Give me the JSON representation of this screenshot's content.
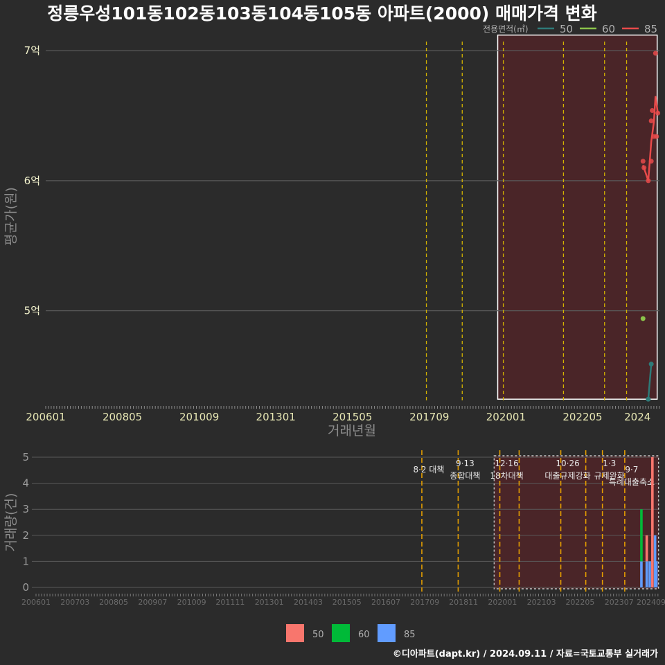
{
  "title": "정릉우성101동102동103동104동105동 아파트(2000) 매매가격 변화",
  "credit": "©디아파트(dapt.kr) / 2024.09.11 / 자료=국토교통부 실거래가",
  "colors": {
    "background": "#2b2b2b",
    "grid": "#5a5a5a",
    "policy_line": "#d4b400",
    "policy_line_bottom": "#e69f00",
    "highlight_fill": "#4a2528",
    "s50": "#2e7a78",
    "s60": "#8bc34a",
    "s85": "#e84a4a",
    "bar50": "#f8766d",
    "bar60": "#00ba38",
    "bar85": "#619cff"
  },
  "chart_data": [
    {
      "type": "line",
      "name": "price",
      "ylabel": "평균가(원)",
      "xlabel": "거래년월",
      "ylim": [
        4.3,
        7.15
      ],
      "ytick_values": [
        5,
        6,
        7
      ],
      "ytick_labels": [
        "5억",
        "6억",
        "7억"
      ],
      "x_range": [
        2006.0,
        2024.67
      ],
      "xtick_values": [
        2006.0,
        2008.33,
        2010.67,
        2013.0,
        2015.33,
        2017.67,
        2020.0,
        2022.33,
        2024.0
      ],
      "xtick_labels": [
        "200601",
        "200805",
        "201009",
        "201301",
        "201505",
        "201709",
        "202001",
        "202205",
        "2024"
      ],
      "policy_lines_x": [
        2017.58,
        2018.67,
        2019.92,
        2021.75,
        2023.0,
        2023.67
      ],
      "highlight_x": [
        2019.75,
        2024.6
      ],
      "highlight_y": [
        4.32,
        7.12
      ],
      "legend_title": "전용면적(㎡)",
      "series": [
        {
          "name": "50",
          "color": "#2e7a78",
          "x": [
            2024.33,
            2024.42
          ],
          "y": [
            4.32,
            4.59
          ]
        },
        {
          "name": "60",
          "color": "#8bc34a",
          "x": [
            2024.17
          ],
          "y": [
            4.94
          ]
        },
        {
          "name": "85",
          "color": "#e84a4a",
          "points_x": [
            2024.17,
            2024.2,
            2024.33,
            2024.42,
            2024.42,
            2024.45,
            2024.5,
            2024.55,
            2024.58,
            2024.62
          ],
          "points_y": [
            6.15,
            6.1,
            6.0,
            6.15,
            6.46,
            6.54,
            6.34,
            6.98,
            6.34,
            6.52
          ],
          "x": [
            2024.17,
            2024.33,
            2024.42,
            2024.5,
            2024.55,
            2024.62
          ],
          "y": [
            6.12,
            6.0,
            6.3,
            6.45,
            6.65,
            6.52
          ]
        }
      ]
    },
    {
      "type": "bar",
      "name": "volume",
      "ylabel": "거래량(건)",
      "ylim": [
        0,
        5
      ],
      "ytick_values": [
        0,
        1,
        2,
        3,
        4,
        5
      ],
      "ytick_labels": [
        "0",
        "1",
        "2",
        "3",
        "4",
        "5"
      ],
      "x_range": [
        2006.0,
        2024.67
      ],
      "xtick_values": [
        2006.0,
        2007.17,
        2008.33,
        2009.5,
        2010.67,
        2011.83,
        2013.0,
        2014.17,
        2015.33,
        2016.5,
        2017.67,
        2018.83,
        2020.0,
        2021.17,
        2022.33,
        2023.5,
        2024.67
      ],
      "xtick_labels": [
        "200601",
        "200703",
        "200805",
        "200907",
        "201009",
        "201111",
        "201301",
        "201403",
        "201505",
        "201607",
        "201709",
        "201811",
        "202001",
        "202103",
        "202205",
        "202307",
        "202409"
      ],
      "policy_lines_x": [
        2017.58,
        2018.67,
        2019.92,
        2020.5,
        2021.75,
        2022.5,
        2023.0,
        2023.67
      ],
      "highlight_x": [
        2019.75,
        2024.6
      ],
      "annotations": [
        {
          "x": 2017.58,
          "lines": [
            "8·2 대책"
          ],
          "row": 1
        },
        {
          "x": 2018.67,
          "lines": [
            "9·13",
            "종합대책"
          ],
          "row": 0
        },
        {
          "x": 2019.92,
          "lines": [
            "12·16",
            "18차대책"
          ],
          "row": 0
        },
        {
          "x": 2021.75,
          "lines": [
            "10·26",
            "대출규제강화"
          ],
          "row": 0
        },
        {
          "x": 2023.0,
          "lines": [
            "1·3",
            "규제완화"
          ],
          "row": 0
        },
        {
          "x": 2023.67,
          "lines": [
            "9·7",
            "특례대출축소"
          ],
          "row": 1
        }
      ],
      "series": [
        {
          "name": "50",
          "color": "#f8766d"
        },
        {
          "name": "60",
          "color": "#00ba38"
        },
        {
          "name": "85",
          "color": "#619cff"
        }
      ],
      "stacks": [
        {
          "x": 2024.17,
          "values": {
            "60": 2,
            "85": 1
          }
        },
        {
          "x": 2024.33,
          "values": {
            "50": 1,
            "85": 1
          }
        },
        {
          "x": 2024.42,
          "values": {
            "85": 1
          }
        },
        {
          "x": 2024.5,
          "values": {
            "50": 5
          }
        },
        {
          "x": 2024.58,
          "values": {
            "85": 2
          }
        },
        {
          "x": 2024.62,
          "values": {
            "85": 1
          }
        }
      ]
    }
  ]
}
